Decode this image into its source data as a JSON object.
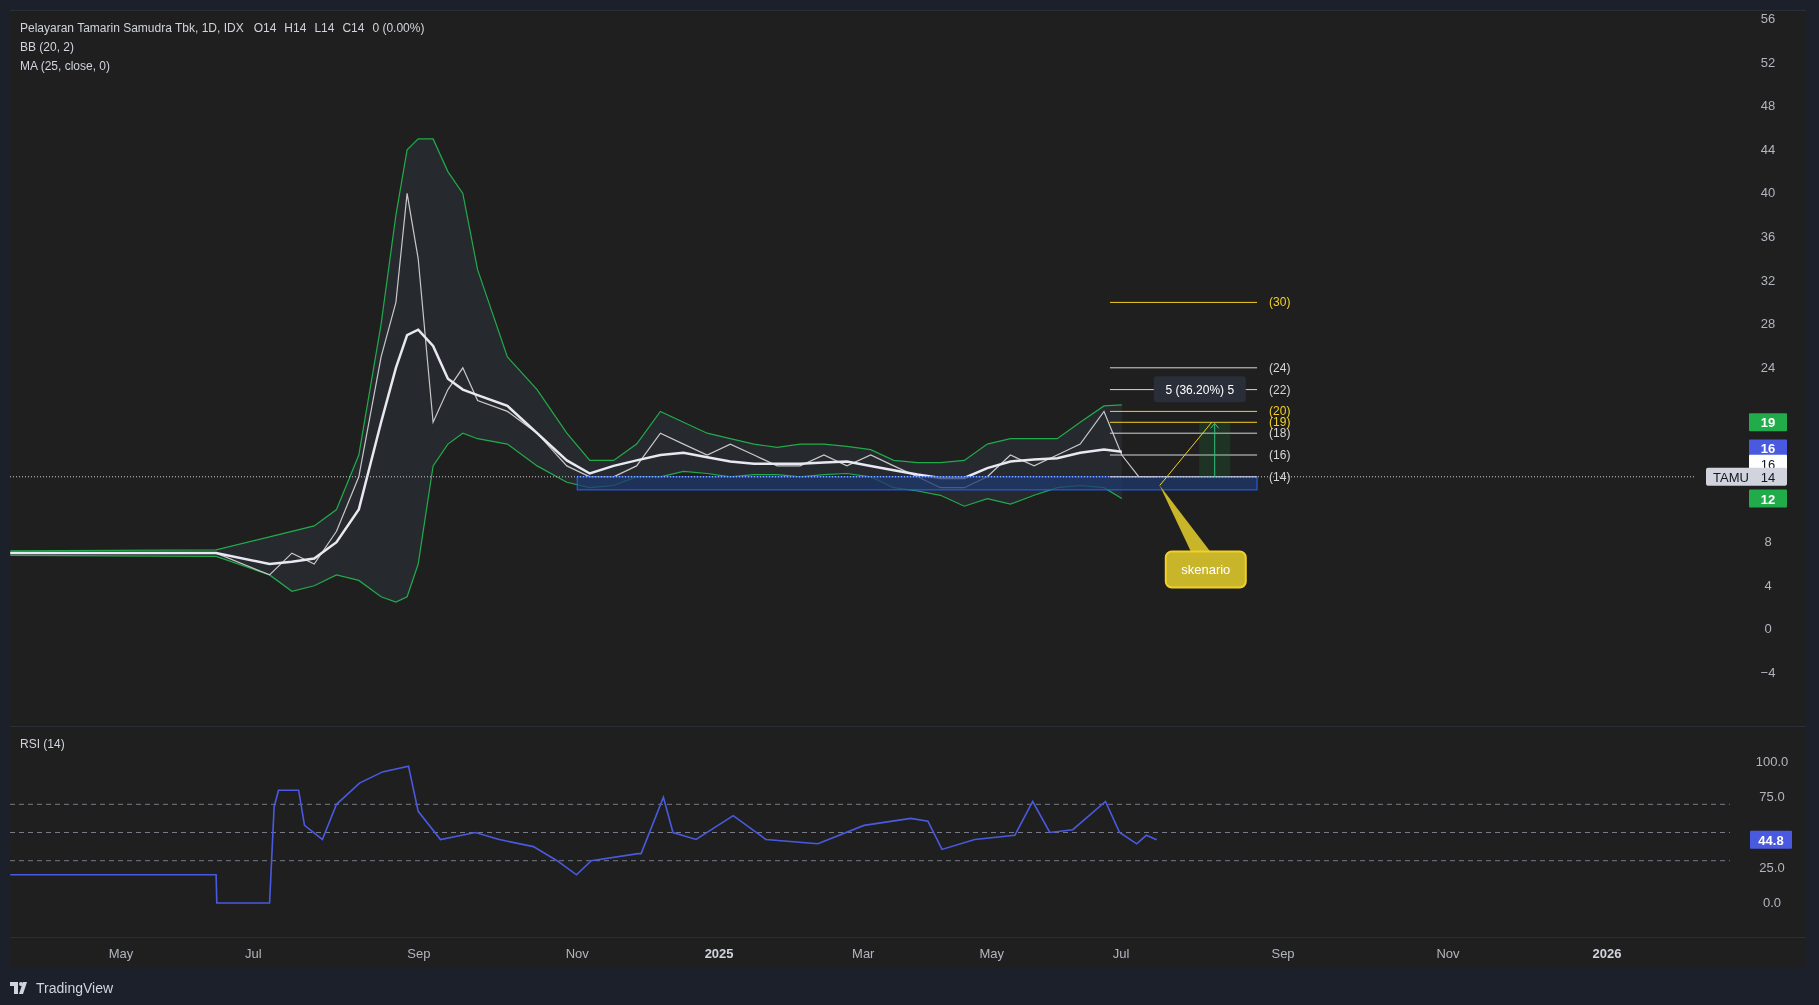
{
  "legend": {
    "title": "Pelayaran Tamarin Samudra Tbk, 1D, IDX",
    "ohlc": [
      "O14",
      "H14",
      "L14",
      "C14",
      "0 (0.00%)"
    ],
    "indicators": [
      "BB (20, 2)",
      "MA (25, close, 0)"
    ]
  },
  "price_axis": [
    "56",
    "52",
    "48",
    "44",
    "40",
    "36",
    "32",
    "28",
    "24",
    "8",
    "4",
    "0",
    "−4"
  ],
  "levels": [
    {
      "label": "(30)",
      "color": "#f2d024"
    },
    {
      "label": "(24)",
      "color": "#d6d6d6"
    },
    {
      "label": "(22)",
      "color": "#d6d6d6"
    },
    {
      "label": "(20)",
      "color": "#f2d024"
    },
    {
      "label": "(19)",
      "color": "#f2d024"
    },
    {
      "label": "(18)",
      "color": "#d6d6d6"
    },
    {
      "label": "(16)",
      "color": "#d6d6d6"
    },
    {
      "label": "(14)",
      "color": "#d6d6d6"
    }
  ],
  "measure": {
    "label": "5 (36.20%) 5"
  },
  "callout": {
    "label": "skenario"
  },
  "price_badges": [
    {
      "label": "19",
      "color": "#22ab4a",
      "kind": "filled"
    },
    {
      "label": "16",
      "color": "#4a5ae0",
      "kind": "filled"
    },
    {
      "label": "16",
      "color": "#ffffff",
      "kind": "plain"
    },
    {
      "label": "12",
      "color": "#22ab4a",
      "kind": "filled"
    }
  ],
  "symbol_badge": {
    "symbol": "TAMU",
    "value": "14"
  },
  "rsi": {
    "title": "RSI (14)",
    "axis": [
      "100.0",
      "75.0",
      "25.0",
      "0.0"
    ],
    "badge": {
      "label": "44.8",
      "color": "#4a5ae0"
    }
  },
  "time_axis": [
    {
      "label": "May",
      "kind": "month"
    },
    {
      "label": "Jul",
      "kind": "month"
    },
    {
      "label": "Sep",
      "kind": "month"
    },
    {
      "label": "Nov",
      "kind": "month"
    },
    {
      "label": "2025",
      "kind": "year"
    },
    {
      "label": "Mar",
      "kind": "month"
    },
    {
      "label": "May",
      "kind": "month"
    },
    {
      "label": "Jul",
      "kind": "month"
    },
    {
      "label": "Sep",
      "kind": "month"
    },
    {
      "label": "Nov",
      "kind": "month"
    },
    {
      "label": "2026",
      "kind": "year"
    }
  ],
  "footer": {
    "brand": "TradingView"
  }
}
